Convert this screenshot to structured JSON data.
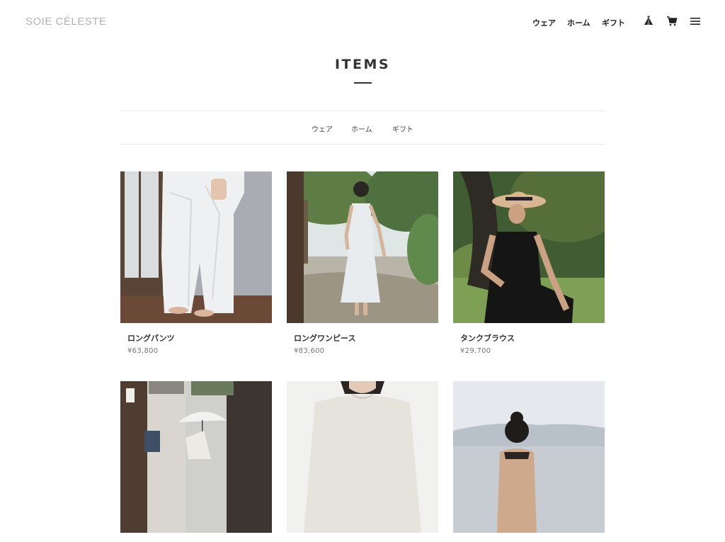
{
  "header": {
    "logo": "SOIE CÉLESTE",
    "nav": [
      {
        "label": "ウェア"
      },
      {
        "label": "ホーム"
      },
      {
        "label": "ギフト"
      }
    ],
    "icons": [
      "tent-icon",
      "cart-icon",
      "menu-icon"
    ]
  },
  "main": {
    "title": "ITEMS",
    "categories": [
      {
        "label": "ウェア"
      },
      {
        "label": "ホーム"
      },
      {
        "label": "ギフト"
      }
    ],
    "products": [
      {
        "name": "ロングパンツ",
        "price": "¥63,800"
      },
      {
        "name": "ロングワンピース",
        "price": "¥83,600"
      },
      {
        "name": "タンクブラウス",
        "price": "¥29,700"
      },
      {
        "name": "",
        "price": ""
      },
      {
        "name": "",
        "price": ""
      },
      {
        "name": "",
        "price": ""
      }
    ]
  }
}
